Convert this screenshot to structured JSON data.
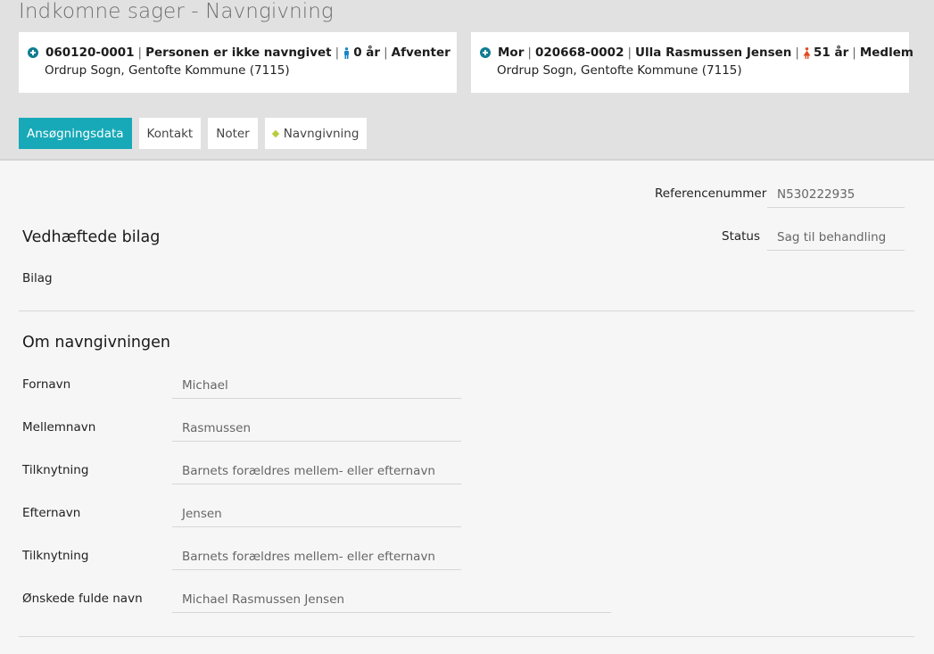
{
  "page": {
    "title": "Indkomne sager - Navngivning"
  },
  "cards": {
    "child": {
      "cpr": "060120-0001",
      "name": "Personen er ikke navngivet",
      "age": "0 år",
      "status": "Afventer",
      "location": "Ordrup Sogn, Gentofte Kommune (7115)",
      "gender_color": "#1a86c8"
    },
    "mother": {
      "relation": "Mor",
      "cpr": "020668-0002",
      "name": "Ulla Rasmussen Jensen",
      "age": "51 år",
      "status": "Medlem",
      "location": "Ordrup Sogn, Gentofte Kommune (7115)",
      "gender_color": "#e2481c"
    }
  },
  "tabs": [
    {
      "label": "Ansøgningsdata",
      "active": true
    },
    {
      "label": "Kontakt"
    },
    {
      "label": "Noter"
    },
    {
      "label": "Navngivning"
    }
  ],
  "meta": {
    "ref_label": "Referencenummer",
    "ref_value": "N530222935",
    "status_label": "Status",
    "status_value": "Sag til behandling"
  },
  "attachments": {
    "title": "Vedhæftede bilag",
    "label": "Bilag"
  },
  "naming": {
    "title": "Om navngivningen",
    "fields": [
      {
        "label": "Fornavn",
        "value": "Michael"
      },
      {
        "label": "Mellemnavn",
        "value": "Rasmussen"
      },
      {
        "label": "Tilknytning",
        "value": "Barnets forældres mellem- eller efternavn"
      },
      {
        "label": "Efternavn",
        "value": "Jensen"
      },
      {
        "label": "Tilknytning",
        "value": "Barnets forældres mellem- eller efternavn"
      },
      {
        "label": "Ønskede fulde navn",
        "value": "Michael Rasmussen Jensen"
      }
    ]
  },
  "colors": {
    "accent": "#17a9b8",
    "icon": "#0f7d92",
    "tab_marker": "#b9cc3a"
  }
}
